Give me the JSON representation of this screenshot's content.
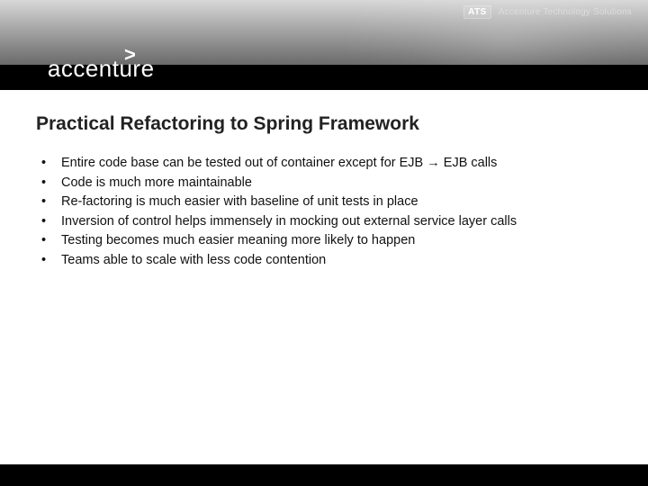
{
  "header": {
    "logo_chevron": ">",
    "logo_text": "accenture",
    "ats_badge": "ATS",
    "ats_text": "Accenture Technology Solutions"
  },
  "title": "Practical Refactoring to Spring Framework",
  "bullets": [
    "Entire code base can be tested out of container except for EJB → EJB calls",
    "Code is much more maintainable",
    "Re-factoring is much easier with baseline of unit tests in place",
    "Inversion of control helps immensely in mocking out external service layer calls",
    "Testing becomes much easier meaning more likely to happen",
    "Teams able to scale with less code contention"
  ]
}
